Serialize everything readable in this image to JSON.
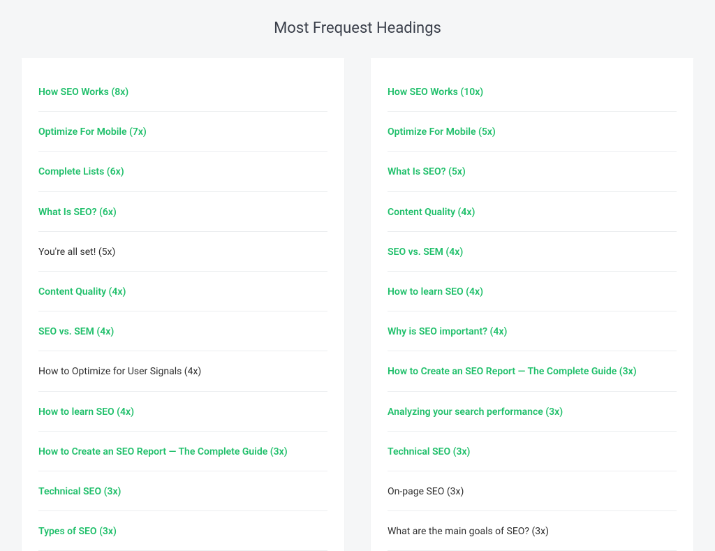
{
  "title": "Most Frequest Headings",
  "columns": [
    {
      "items": [
        {
          "label": "How SEO Works (8x)",
          "link": true
        },
        {
          "label": "Optimize For Mobile (7x)",
          "link": true
        },
        {
          "label": "Complete Lists (6x)",
          "link": true
        },
        {
          "label": "What Is SEO? (6x)",
          "link": true
        },
        {
          "label": "You're all set! (5x)",
          "link": false
        },
        {
          "label": "Content Quality (4x)",
          "link": true
        },
        {
          "label": "SEO vs. SEM (4x)",
          "link": true
        },
        {
          "label": "How to Optimize for User Signals (4x)",
          "link": false
        },
        {
          "label": "How to learn SEO (4x)",
          "link": true
        },
        {
          "label": "How to Create an SEO Report — The Complete Guide (3x)",
          "link": true
        },
        {
          "label": "Technical SEO (3x)",
          "link": true
        },
        {
          "label": "Types of SEO (3x)",
          "link": true
        }
      ]
    },
    {
      "items": [
        {
          "label": "How SEO Works (10x)",
          "link": true
        },
        {
          "label": "Optimize For Mobile (5x)",
          "link": true
        },
        {
          "label": "What Is SEO? (5x)",
          "link": true
        },
        {
          "label": "Content Quality (4x)",
          "link": true
        },
        {
          "label": "SEO vs. SEM (4x)",
          "link": true
        },
        {
          "label": "How to learn SEO (4x)",
          "link": true
        },
        {
          "label": "Why is SEO important? (4x)",
          "link": true
        },
        {
          "label": "How to Create an SEO Report — The Complete Guide (3x)",
          "link": true
        },
        {
          "label": "Analyzing your search performance (3x)",
          "link": true
        },
        {
          "label": "Technical SEO (3x)",
          "link": true
        },
        {
          "label": "On-page SEO (3x)",
          "link": false
        },
        {
          "label": "What are the main goals of SEO? (3x)",
          "link": false
        }
      ]
    }
  ]
}
